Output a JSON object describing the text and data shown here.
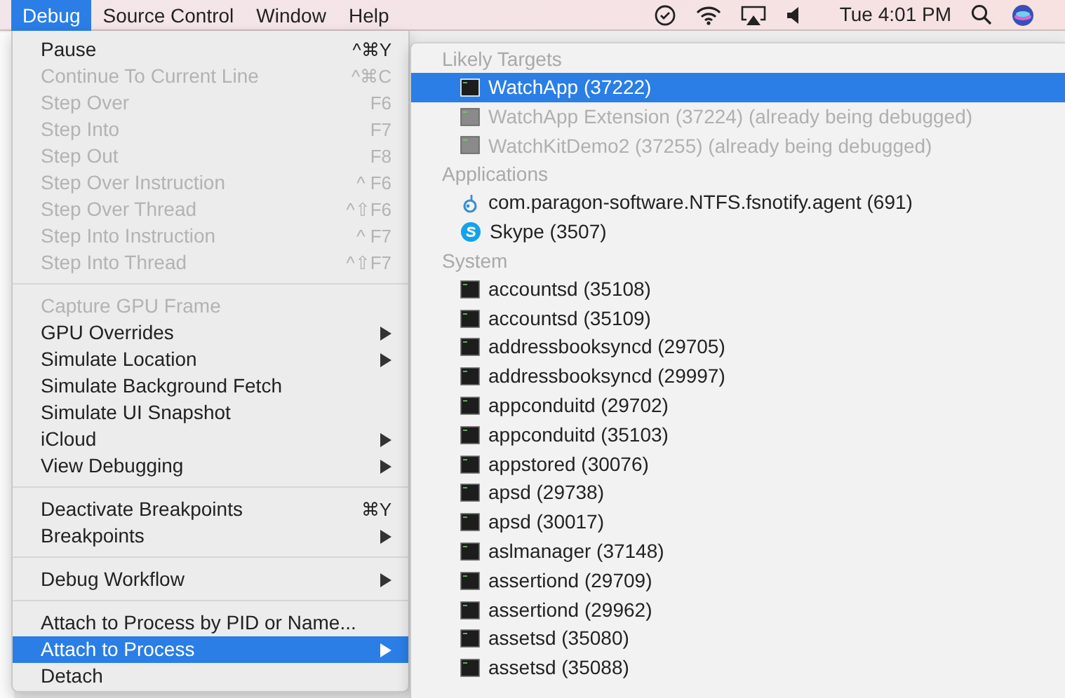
{
  "menu_bar": {
    "menus": [
      {
        "label": "Debug",
        "selected": true
      },
      {
        "label": "Source Control",
        "selected": false
      },
      {
        "label": "Window",
        "selected": false
      },
      {
        "label": "Help",
        "selected": false
      }
    ],
    "clock": "Tue 4:01 PM"
  },
  "debug_menu": {
    "items": [
      {
        "kind": "item",
        "label": "Pause",
        "shortcut": "^⌘Y",
        "disabled": false,
        "submenu": false,
        "selected": false
      },
      {
        "kind": "item",
        "label": "Continue To Current Line",
        "shortcut": "^⌘C",
        "disabled": true,
        "submenu": false,
        "selected": false
      },
      {
        "kind": "item",
        "label": "Step Over",
        "shortcut": "F6",
        "disabled": true,
        "submenu": false,
        "selected": false
      },
      {
        "kind": "item",
        "label": "Step Into",
        "shortcut": "F7",
        "disabled": true,
        "submenu": false,
        "selected": false
      },
      {
        "kind": "item",
        "label": "Step Out",
        "shortcut": "F8",
        "disabled": true,
        "submenu": false,
        "selected": false
      },
      {
        "kind": "item",
        "label": "Step Over Instruction",
        "shortcut": "^ F6",
        "disabled": true,
        "submenu": false,
        "selected": false
      },
      {
        "kind": "item",
        "label": "Step Over Thread",
        "shortcut": "^⇧F6",
        "disabled": true,
        "submenu": false,
        "selected": false
      },
      {
        "kind": "item",
        "label": "Step Into Instruction",
        "shortcut": "^ F7",
        "disabled": true,
        "submenu": false,
        "selected": false
      },
      {
        "kind": "item",
        "label": "Step Into Thread",
        "shortcut": "^⇧F7",
        "disabled": true,
        "submenu": false,
        "selected": false
      },
      {
        "kind": "separator"
      },
      {
        "kind": "item",
        "label": "Capture GPU Frame",
        "disabled": true,
        "submenu": false,
        "selected": false
      },
      {
        "kind": "item",
        "label": "GPU Overrides",
        "disabled": false,
        "submenu": true,
        "selected": false
      },
      {
        "kind": "item",
        "label": "Simulate Location",
        "disabled": false,
        "submenu": true,
        "selected": false
      },
      {
        "kind": "item",
        "label": "Simulate Background Fetch",
        "disabled": false,
        "submenu": false,
        "selected": false
      },
      {
        "kind": "item",
        "label": "Simulate UI Snapshot",
        "disabled": false,
        "submenu": false,
        "selected": false
      },
      {
        "kind": "item",
        "label": "iCloud",
        "disabled": false,
        "submenu": true,
        "selected": false
      },
      {
        "kind": "item",
        "label": "View Debugging",
        "disabled": false,
        "submenu": true,
        "selected": false
      },
      {
        "kind": "separator"
      },
      {
        "kind": "item",
        "label": "Deactivate Breakpoints",
        "shortcut": "⌘Y",
        "disabled": false,
        "submenu": false,
        "selected": false
      },
      {
        "kind": "item",
        "label": "Breakpoints",
        "disabled": false,
        "submenu": true,
        "selected": false
      },
      {
        "kind": "separator"
      },
      {
        "kind": "item",
        "label": "Debug Workflow",
        "disabled": false,
        "submenu": true,
        "selected": false
      },
      {
        "kind": "separator"
      },
      {
        "kind": "item",
        "label": "Attach to Process by PID or Name...",
        "disabled": false,
        "submenu": false,
        "selected": false
      },
      {
        "kind": "item",
        "label": "Attach to Process",
        "disabled": false,
        "submenu": true,
        "selected": true
      },
      {
        "kind": "item",
        "label": "Detach",
        "disabled": false,
        "submenu": false,
        "selected": false
      }
    ]
  },
  "process_menu": {
    "sections": [
      {
        "header": "Likely Targets",
        "items": [
          {
            "label": "WatchApp (37222)",
            "kind": "terminal",
            "disabled": false,
            "selected": true
          },
          {
            "label": "WatchApp Extension (37224) (already being debugged)",
            "kind": "terminal",
            "disabled": true,
            "selected": false
          },
          {
            "label": "WatchKitDemo2 (37255) (already being debugged)",
            "kind": "terminal",
            "disabled": true,
            "selected": false
          }
        ]
      },
      {
        "header": "Applications",
        "items": [
          {
            "label": "com.paragon-software.NTFS.fsnotify.agent (691)",
            "kind": "agent",
            "disabled": false,
            "selected": false
          },
          {
            "label": "Skype (3507)",
            "kind": "skype",
            "disabled": false,
            "selected": false
          }
        ]
      },
      {
        "header": "System",
        "items": [
          {
            "label": "accountsd (35108)",
            "kind": "terminal",
            "disabled": false,
            "selected": false
          },
          {
            "label": "accountsd (35109)",
            "kind": "terminal",
            "disabled": false,
            "selected": false
          },
          {
            "label": "addressbooksyncd (29705)",
            "kind": "terminal",
            "disabled": false,
            "selected": false
          },
          {
            "label": "addressbooksyncd (29997)",
            "kind": "terminal",
            "disabled": false,
            "selected": false
          },
          {
            "label": "appconduitd (29702)",
            "kind": "terminal",
            "disabled": false,
            "selected": false
          },
          {
            "label": "appconduitd (35103)",
            "kind": "terminal",
            "disabled": false,
            "selected": false
          },
          {
            "label": "appstored (30076)",
            "kind": "terminal",
            "disabled": false,
            "selected": false
          },
          {
            "label": "apsd (29738)",
            "kind": "terminal",
            "disabled": false,
            "selected": false
          },
          {
            "label": "apsd (30017)",
            "kind": "terminal",
            "disabled": false,
            "selected": false
          },
          {
            "label": "aslmanager (37148)",
            "kind": "terminal",
            "disabled": false,
            "selected": false
          },
          {
            "label": "assertiond (29709)",
            "kind": "terminal",
            "disabled": false,
            "selected": false
          },
          {
            "label": "assertiond (29962)",
            "kind": "terminal",
            "disabled": false,
            "selected": false
          },
          {
            "label": "assetsd (35080)",
            "kind": "terminal",
            "disabled": false,
            "selected": false
          },
          {
            "label": "assetsd (35088)",
            "kind": "terminal",
            "disabled": false,
            "selected": false
          }
        ]
      }
    ]
  }
}
